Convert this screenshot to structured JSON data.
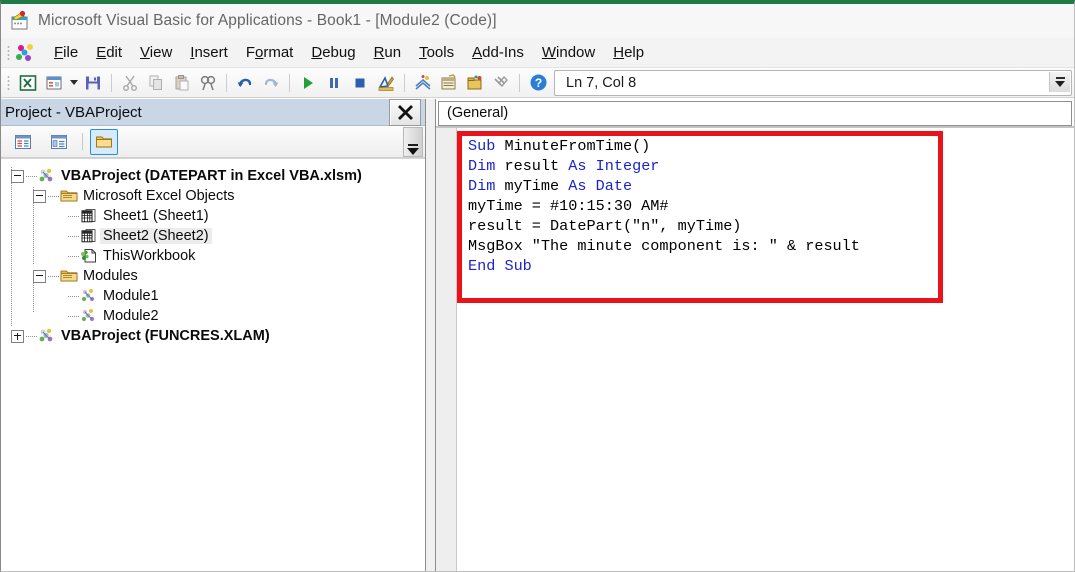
{
  "window": {
    "title": "Microsoft Visual Basic for Applications - Book1 - [Module2 (Code)]",
    "app_icon": "vba-app-icon",
    "accent_green": "#1f7a45"
  },
  "menubar": {
    "icon": "vba-menu-icon",
    "items": [
      {
        "label": "File",
        "accel": "F"
      },
      {
        "label": "Edit",
        "accel": "E"
      },
      {
        "label": "View",
        "accel": "V"
      },
      {
        "label": "Insert",
        "accel": "I"
      },
      {
        "label": "Format",
        "accel": "o"
      },
      {
        "label": "Debug",
        "accel": "D"
      },
      {
        "label": "Run",
        "accel": "R"
      },
      {
        "label": "Tools",
        "accel": "T"
      },
      {
        "label": "Add-Ins",
        "accel": "A"
      },
      {
        "label": "Window",
        "accel": "W"
      },
      {
        "label": "Help",
        "accel": "H"
      }
    ]
  },
  "toolbar": {
    "buttons": [
      {
        "name": "view-excel-icon",
        "title": "View Microsoft Excel"
      },
      {
        "name": "insert-userform-icon",
        "title": "Insert UserForm"
      },
      {
        "name": "insert-dropdown-caret",
        "title": "Insert"
      },
      {
        "name": "save-icon",
        "title": "Save Book1"
      },
      {
        "name": "cut-icon",
        "title": "Cut"
      },
      {
        "name": "copy-icon",
        "title": "Copy"
      },
      {
        "name": "paste-icon",
        "title": "Paste"
      },
      {
        "name": "find-icon",
        "title": "Find"
      },
      {
        "name": "undo-icon",
        "title": "Undo"
      },
      {
        "name": "redo-icon",
        "title": "Redo"
      },
      {
        "name": "run-icon",
        "title": "Run Sub/UserForm"
      },
      {
        "name": "pause-icon",
        "title": "Break"
      },
      {
        "name": "stop-icon",
        "title": "Reset"
      },
      {
        "name": "design-mode-icon",
        "title": "Design Mode"
      },
      {
        "name": "project-explorer-icon",
        "title": "Project Explorer"
      },
      {
        "name": "properties-window-icon",
        "title": "Properties Window"
      },
      {
        "name": "object-browser-icon",
        "title": "Object Browser"
      },
      {
        "name": "toolbox-icon",
        "title": "Toolbox"
      },
      {
        "name": "help-icon",
        "title": "Help"
      }
    ],
    "status": {
      "line_col": "Ln 7, Col 8"
    }
  },
  "project_pane": {
    "header_title": "Project - VBAProject",
    "close_label": "Close",
    "toolbar_buttons": [
      {
        "name": "view-code-button",
        "label": "View Code",
        "active": false
      },
      {
        "name": "view-object-button",
        "label": "View Object",
        "active": false
      },
      {
        "name": "toggle-folders-button",
        "label": "Toggle Folders",
        "active": true
      }
    ],
    "tree": [
      {
        "label": "VBAProject (DATEPART in Excel VBA.xlsm)",
        "depth": 0,
        "icon": "project-icon",
        "expander": "minus",
        "bold": true,
        "selected": false
      },
      {
        "label": "Microsoft Excel Objects",
        "depth": 1,
        "icon": "folder-icon",
        "expander": "minus",
        "bold": false,
        "selected": false
      },
      {
        "label": "Sheet1 (Sheet1)",
        "depth": 2,
        "icon": "sheet-icon",
        "expander": "none",
        "bold": false,
        "selected": false
      },
      {
        "label": "Sheet2 (Sheet2)",
        "depth": 2,
        "icon": "sheet-icon",
        "expander": "none",
        "bold": false,
        "selected": true
      },
      {
        "label": "ThisWorkbook",
        "depth": 2,
        "icon": "workbook-icon",
        "expander": "none",
        "bold": false,
        "selected": false
      },
      {
        "label": "Modules",
        "depth": 1,
        "icon": "folder-icon",
        "expander": "minus",
        "bold": false,
        "selected": false
      },
      {
        "label": "Module1",
        "depth": 2,
        "icon": "module-icon",
        "expander": "none",
        "bold": false,
        "selected": false
      },
      {
        "label": "Module2",
        "depth": 2,
        "icon": "module-icon",
        "expander": "none",
        "bold": false,
        "selected": false
      },
      {
        "label": "VBAProject (FUNCRES.XLAM)",
        "depth": 0,
        "icon": "project-icon",
        "expander": "plus",
        "bold": true,
        "selected": false
      }
    ]
  },
  "code_pane": {
    "object_dropdown": "(General)",
    "procedure_dropdown": "",
    "highlight_color": "#e8131b",
    "keyword_color": "#1b24c9",
    "text_color": "#000000",
    "code_lines": [
      [
        {
          "t": "Sub ",
          "c": "kw"
        },
        {
          "t": "MinuteFromTime()",
          "c": "pt"
        }
      ],
      [
        {
          "t": "Dim ",
          "c": "kw"
        },
        {
          "t": "result ",
          "c": "pt"
        },
        {
          "t": "As Integer",
          "c": "kw"
        }
      ],
      [
        {
          "t": "Dim ",
          "c": "kw"
        },
        {
          "t": "myTime ",
          "c": "pt"
        },
        {
          "t": "As Date",
          "c": "kw"
        }
      ],
      [
        {
          "t": "myTime = #10:15:30 AM#",
          "c": "pt"
        }
      ],
      [
        {
          "t": "result = DatePart(\"n\", myTime)",
          "c": "pt"
        }
      ],
      [
        {
          "t": "MsgBox \"The minute component is: \" & result",
          "c": "pt"
        }
      ],
      [
        {
          "t": "End Sub",
          "c": "kw"
        }
      ]
    ],
    "code_plain": "Sub MinuteFromTime()\nDim result As Integer\nDim myTime As Date\nmyTime = #10:15:30 AM#\nresult = DatePart(\"n\", myTime)\nMsgBox \"The minute component is: \" & result\nEnd Sub"
  }
}
